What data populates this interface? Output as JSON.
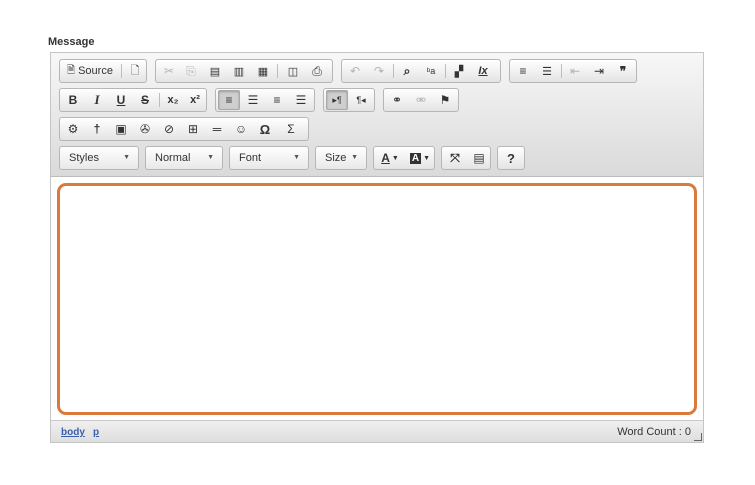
{
  "field": {
    "label": "Message"
  },
  "toolbar": {
    "source_label": "Source",
    "bold": "B",
    "italic": "I",
    "underline": "U",
    "strike": "S",
    "subscript": "x₂",
    "superscript": "x²",
    "special_char": "Ω",
    "math": "Σ",
    "quote": "❞",
    "help": "?",
    "link": "⚭",
    "unlink": "⚮",
    "flag": "⚑",
    "undo": "↶",
    "redo": "↷",
    "search": "🔍",
    "replace": "ᵇa",
    "clear_format": "Ix",
    "num_list": "≡",
    "bullet_list": "☰",
    "outdent": "⇤",
    "indent": "⇥",
    "ltr": "▸¶",
    "rtl": "¶◂",
    "smiley": "☺",
    "table": "⊞",
    "hr": "═",
    "image": "▣",
    "flash": "✇",
    "anchor": "⚓",
    "iframe": "◈",
    "gear": "⚙",
    "cut": "✂",
    "copy": "⎘",
    "paste": "📋",
    "preview": "🗎",
    "print": "🖶",
    "maximize": "⛶",
    "showblocks": "▤",
    "text_color": "A",
    "bg_color": "A"
  },
  "combos": {
    "styles": "Styles",
    "format": "Normal",
    "font": "Font",
    "size": "Size"
  },
  "statusbar": {
    "path": [
      "body",
      "p"
    ],
    "word_count": "Word Count : 0"
  },
  "colors": {
    "focus_border": "#d97a3c",
    "path_link": "#3a5fa8"
  }
}
